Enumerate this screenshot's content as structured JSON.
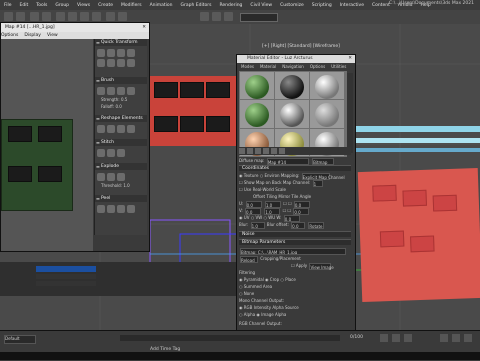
{
  "menu": {
    "items": [
      "File",
      "Edit",
      "Tools",
      "Group",
      "Views",
      "Create",
      "Modifiers",
      "Animation",
      "Graph Editors",
      "Rendering",
      "Civil View",
      "Customize",
      "Scripting",
      "Interactive",
      "Content",
      "Arnold",
      "Help"
    ],
    "window_title": "C:\\...\\Users\\Documents\\3ds Max 2021"
  },
  "viewport": {
    "label": "[+] [Right] [Standard] [Wireframe]"
  },
  "left_window": {
    "title": "Map #14 [...HR_1.jpg]",
    "menu": [
      "Options",
      "Display",
      "View"
    ],
    "tool_sections": [
      {
        "title": "Quick Transform"
      },
      {
        "title": "Brush"
      },
      {
        "title": "Reshape Elements"
      },
      {
        "title": "Stitch"
      },
      {
        "title": "Explode"
      },
      {
        "title": "Peel"
      }
    ],
    "strength_label": "Strength:",
    "strength_value": "0.5",
    "falloff_label": "Falloff:",
    "falloff_value": "0.0",
    "threshold_label": "Threshold:",
    "threshold_value": "1.0"
  },
  "material_editor": {
    "title": "Material Editor - Luz Arcturus",
    "menu": [
      "Modes",
      "Material",
      "Navigation",
      "Options",
      "Utilities"
    ],
    "diffuse_label": "Diffuse map:",
    "map_name": "Map #14",
    "bitmap_label": "Bitmap",
    "coordinates_title": "Coordinates",
    "tex_label": "Texture",
    "env_label": "Environ",
    "mapping_label": "Mapping:",
    "mapping_value": "Explicit Map Channel",
    "show_map_label": "Show Map on Back",
    "map_channel_label": "Map Channel:",
    "map_channel_value": "1",
    "real_world_label": "Use Real-World Scale",
    "offset_label": "Offset",
    "tiling_label": "Tiling",
    "mirror_label": "Mirror Tile",
    "angle_label": "Angle",
    "u_label": "U:",
    "v_label": "V:",
    "w_label": "W:",
    "zero": "0.0",
    "one": "1.0",
    "uv_label": "UV",
    "vw_label": "VW",
    "wu_label": "WU",
    "blur_label": "Blur:",
    "blur_value": "1.0",
    "blur_offset_label": "Blur offset:",
    "blur_offset_value": "0.0",
    "rotate_label": "Rotate",
    "noise_title": "Noise",
    "bitmap_params_title": "Bitmap Parameters",
    "bitmap_path": "Bitmap: C:\\...\\RAM_HR_1.jpg",
    "reload_label": "Reload",
    "cropping_label": "Cropping/Placement",
    "apply_label": "Apply",
    "view_image_label": "View Image",
    "filtering_label": "Filtering",
    "pyramidal_label": "Pyramidal",
    "summed_label": "Summed Area",
    "none_label": "None",
    "crop_label": "Crop",
    "place_label": "Place",
    "mono_label": "Mono Channel Output:",
    "rgb_intensity_label": "RGB Intensity",
    "alpha_label": "Alpha",
    "alpha_source_label": "Alpha Source",
    "image_alpha_label": "Image Alpha",
    "rgb_channel_label": "RGB Channel Output:"
  },
  "bottom": {
    "add_time_tag": "Add Time Tag",
    "frame_counter": "0/100",
    "layer_label": "Default"
  },
  "colors": {
    "viewport_bg": "#4a4a4a",
    "pcb_red": "#c9433a",
    "pcb_green": "#2c4a2a",
    "select_blue": "#1b4fa0"
  }
}
